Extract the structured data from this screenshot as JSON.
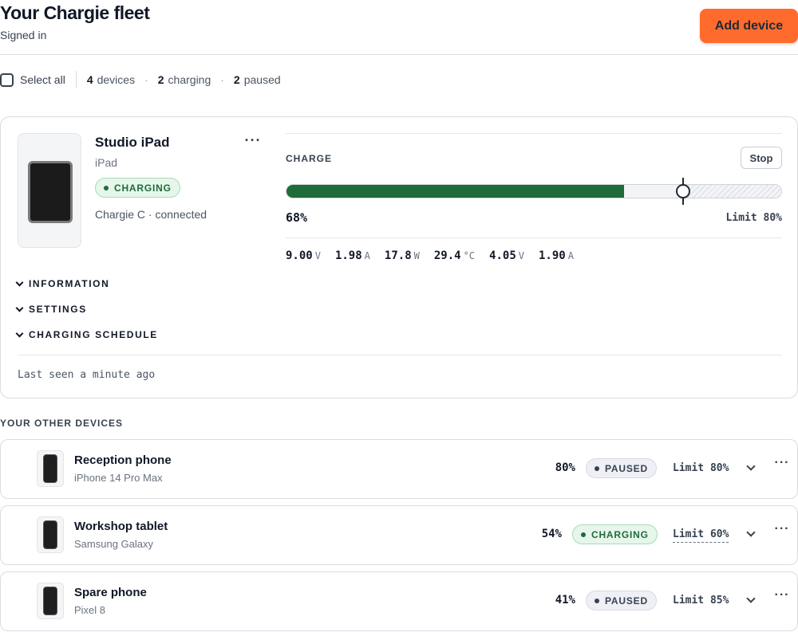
{
  "header": {
    "title": "Your Chargie fleet",
    "subtitle": "Signed in",
    "add_button": "Add device"
  },
  "toolbar": {
    "select_all": "Select all",
    "devices_count": "4",
    "devices_label": "devices",
    "charging_count": "2",
    "charging_label": "charging",
    "paused_count": "2",
    "paused_label": "paused"
  },
  "main_device": {
    "name": "Studio iPad",
    "type": "iPad",
    "status": "CHARGING",
    "connection": "Chargie C · connected",
    "more": "···",
    "charge_label": "CHARGE",
    "stop_button": "Stop",
    "charge_percent": 68,
    "charge_text": "68%",
    "limit_percent": 80,
    "limit_text": "Limit 80%",
    "metrics": [
      {
        "value": "9.00",
        "unit": "V"
      },
      {
        "value": "1.98",
        "unit": "A"
      },
      {
        "value": "17.8",
        "unit": "W"
      },
      {
        "value": "29.4",
        "unit": "°C"
      },
      {
        "value": "4.05",
        "unit": "V"
      },
      {
        "value": "1.90",
        "unit": "A"
      }
    ],
    "sections": [
      "INFORMATION",
      "SETTINGS",
      "CHARGING SCHEDULE"
    ],
    "last_seen": "Last seen a minute ago"
  },
  "other_heading": "YOUR OTHER DEVICES",
  "other_devices": [
    {
      "name": "Reception phone",
      "model": "iPhone 14 Pro Max",
      "percent": "80%",
      "status": "PAUSED",
      "limit": "Limit 80%",
      "more": "···"
    },
    {
      "name": "Workshop tablet",
      "model": "Samsung Galaxy",
      "percent": "54%",
      "status": "CHARGING",
      "limit": "Limit 60%",
      "more": "···"
    },
    {
      "name": "Spare phone",
      "model": "Pixel 8",
      "percent": "41%",
      "status": "PAUSED",
      "limit": "Limit 85%",
      "more": "···"
    }
  ],
  "colors": {
    "accent": "#ff6b2c",
    "charging": "#1f6b3a",
    "charging_bg": "#e6f6ea",
    "paused_bg": "#eef0f5"
  }
}
